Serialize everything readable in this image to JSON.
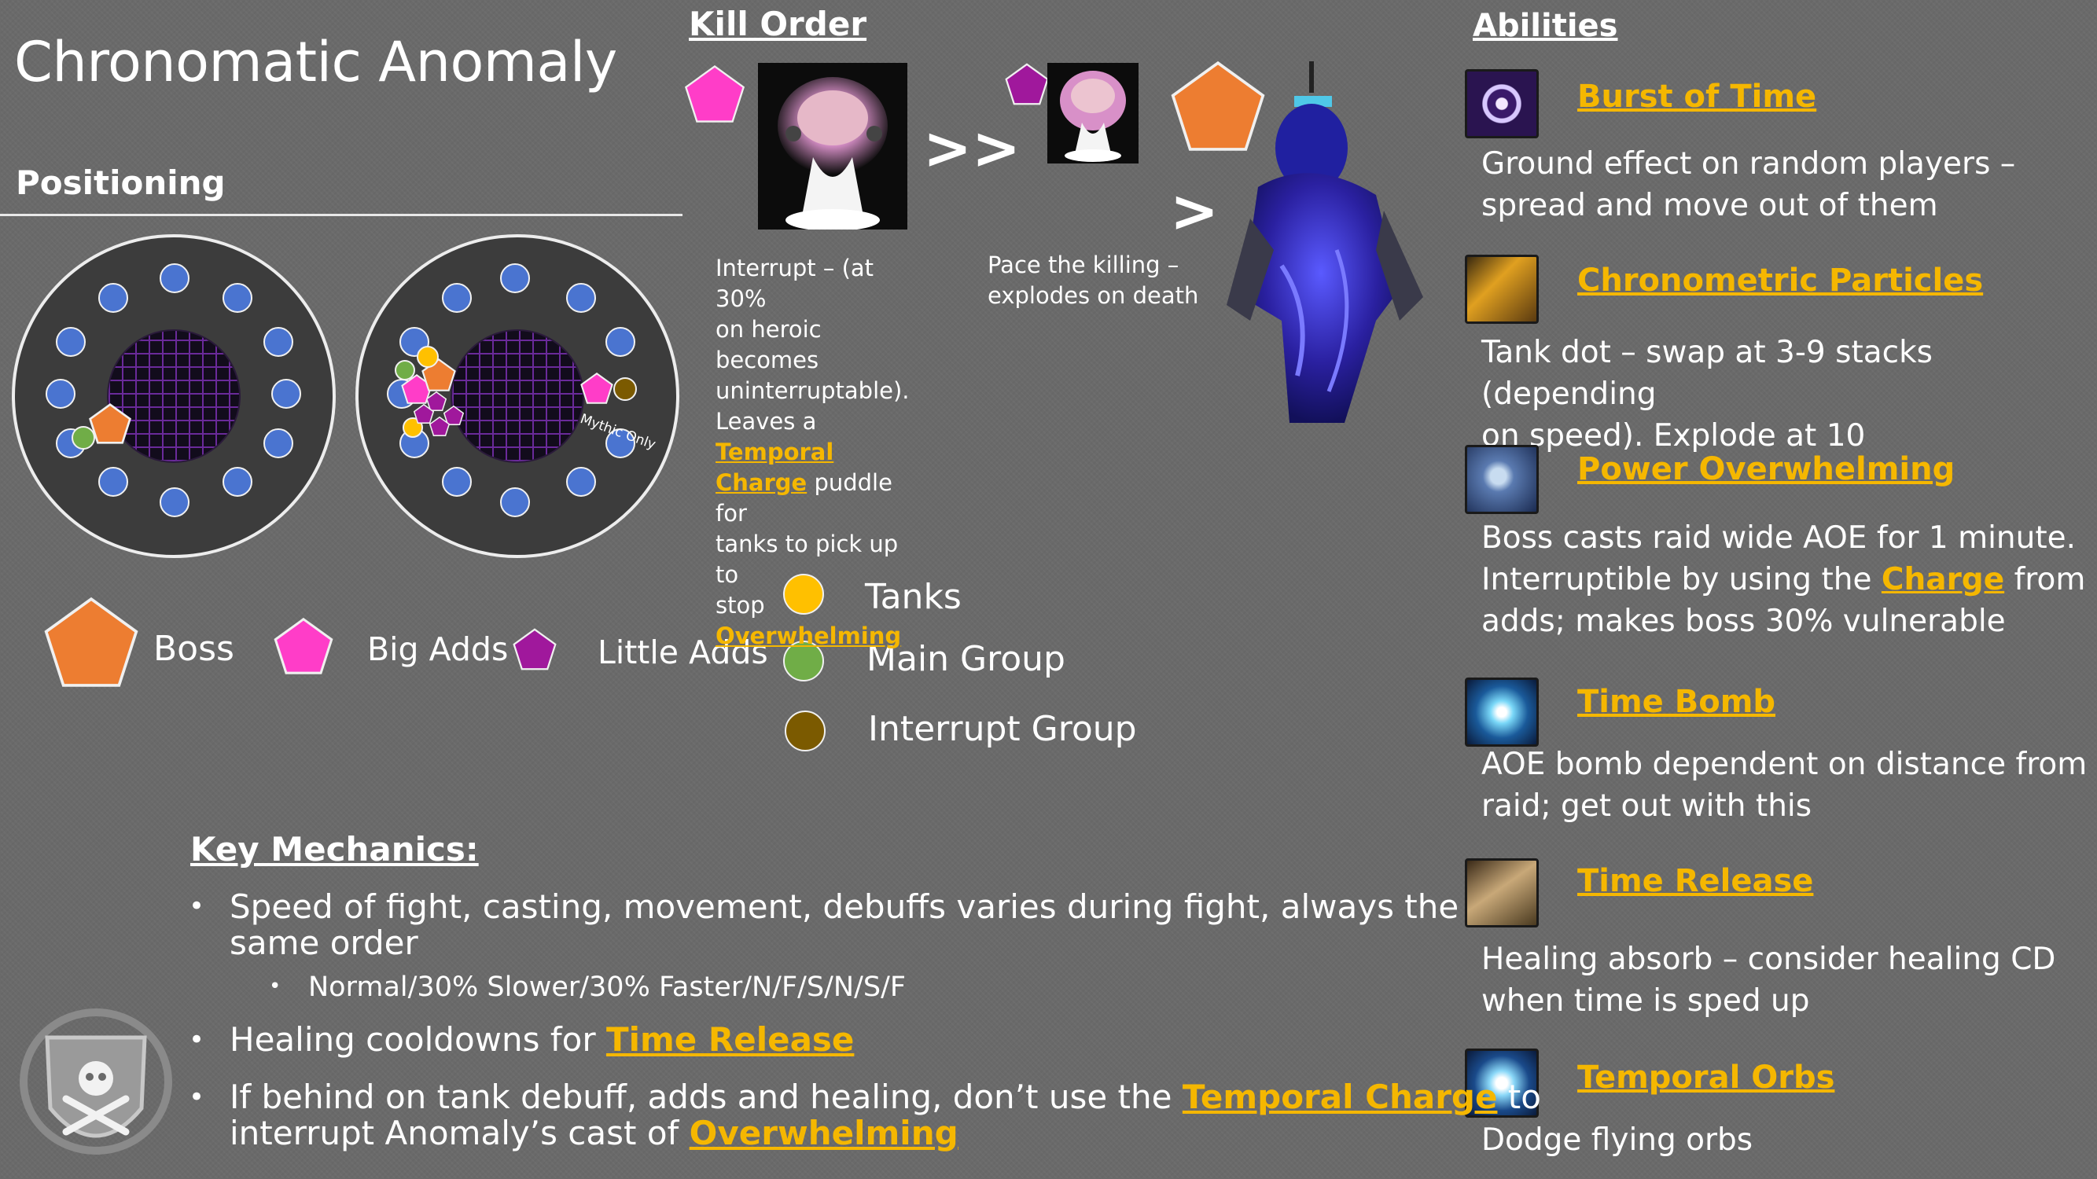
{
  "title": "Chronomatic Anomaly",
  "positioning": {
    "heading": "Positioning",
    "mythic_only_label": "Mythic Only"
  },
  "legend": {
    "boss": "Boss",
    "big_adds": "Big Adds",
    "little_adds": "Little Adds",
    "tanks": "Tanks",
    "main_group": "Main Group",
    "interrupt_group": "Interrupt Group"
  },
  "kill_order": {
    "heading": "Kill Order",
    "arrow_1": ">>",
    "arrow_2": ">",
    "big_add_caption": {
      "line1": "Interrupt – (at 30%",
      "line2": "on heroic becomes",
      "line3": "uninterruptable).",
      "line4_pre": "Leaves a ",
      "line4_link": "Temporal",
      "line5_link": "Charge",
      "line5_post": " puddle for",
      "line6": "tanks to pick up to",
      "line7_pre": "stop ",
      "line7_link": "Overwhelming"
    },
    "little_add_caption": {
      "line1": "Pace the killing –",
      "line2": "explodes on death"
    }
  },
  "abilities": {
    "heading": "Abilities",
    "items": [
      {
        "name": "Burst of Time",
        "icon": "burst-of-time-icon",
        "line1": "Ground effect on random players –",
        "line2": "spread and move out of them"
      },
      {
        "name": "Chronometric Particles",
        "icon": "chronometric-particles-icon",
        "line1": "Tank dot – swap at 3-9 stacks (depending",
        "line2": "on speed).  Explode at 10"
      },
      {
        "name": "Power Overwhelming",
        "icon": "power-overwhelming-icon",
        "line1": "Boss casts raid wide AOE for 1 minute.",
        "line2_pre": "Interruptible by using the ",
        "line2_link": "Charge",
        "line2_post": " from",
        "line3": "adds; makes boss 30% vulnerable"
      },
      {
        "name": "Time Bomb",
        "icon": "time-bomb-icon",
        "line1": "AOE bomb dependent on distance from",
        "line2": "raid; get out with this"
      },
      {
        "name": "Time Release",
        "icon": "time-release-icon",
        "line1": "Healing absorb – consider healing CD",
        "line2": "when time is sped up"
      },
      {
        "name": "Temporal Orbs",
        "icon": "temporal-orbs-icon",
        "line1": "Dodge flying orbs"
      }
    ]
  },
  "key_mechanics": {
    "heading": "Key Mechanics:",
    "bullet_char": "•",
    "b1_line1": "Speed of fight, casting, movement, debuffs varies during fight, always the",
    "b1_line2": "same order",
    "b1_sub": "Normal/30% Slower/30% Faster/N/F/S/N/S/F",
    "b2_pre": "Healing cooldowns for ",
    "b2_link": "Time Release",
    "b3_pre": "If behind on tank debuff, adds and healing, don’t use the ",
    "b3_link": "Temporal Charge",
    "b3_post": " to",
    "b4_pre": "interrupt Anomaly’s cast of ",
    "b4_link": "Overwhelming"
  },
  "colors": {
    "background": "#6a6a6a",
    "link": "#f5b700",
    "boss": "#ed7d31",
    "big_add": "#ff3dc8",
    "little_add": "#a0189c",
    "tank": "#ffc000",
    "main_group": "#70ad47",
    "interrupt_group": "#7b5a00",
    "raid_marker": "#4a74d0"
  }
}
